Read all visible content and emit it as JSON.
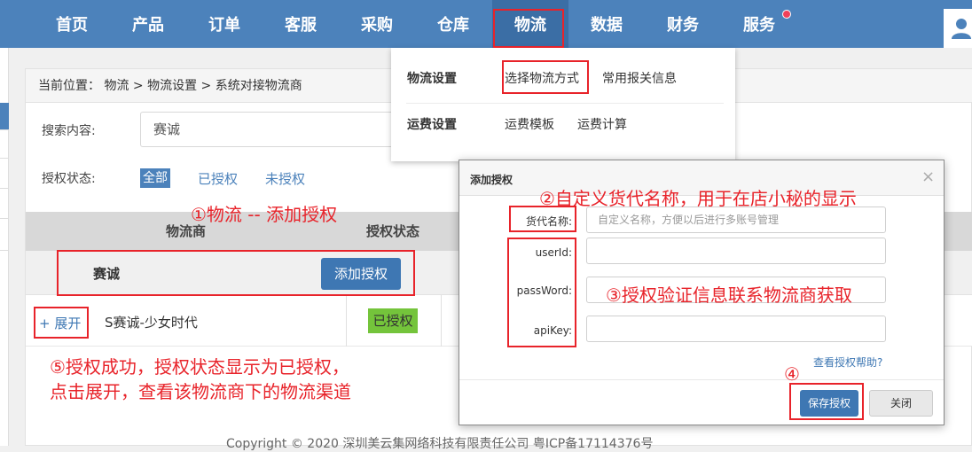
{
  "nav": {
    "items": [
      "首页",
      "产品",
      "订单",
      "客服",
      "采购",
      "仓库",
      "物流",
      "数据",
      "财务",
      "服务"
    ],
    "active": "物流"
  },
  "breadcrumb": "当前位置： 物流 > 物流设置 > 系统对接物流商",
  "search": {
    "label": "搜索内容:",
    "value": "赛诚"
  },
  "auth_filter": {
    "label": "授权状态:",
    "options": [
      "全部",
      "已授权",
      "未授权"
    ],
    "selected": "全部"
  },
  "table": {
    "headers": [
      "物流商",
      "授权状态"
    ],
    "group": {
      "name": "赛诚",
      "button": "添加授权"
    },
    "row": {
      "expand": "+ 展开",
      "channel": "S赛诚-少女时代",
      "status": "已授权"
    }
  },
  "dropdown": {
    "sections": [
      {
        "title": "物流设置",
        "links": [
          "选择物流方式",
          "常用报关信息"
        ]
      },
      {
        "title": "运费设置",
        "links": [
          "运费模板",
          "运费计算"
        ]
      }
    ]
  },
  "modal": {
    "title": "添加授权",
    "close_symbol": "×",
    "fields": [
      {
        "label": "货代名称:",
        "placeholder": "自定义名称，方便以后进行多账号管理"
      },
      {
        "label": "userId:",
        "placeholder": ""
      },
      {
        "label": "passWord:",
        "placeholder": ""
      },
      {
        "label": "apiKey:",
        "placeholder": ""
      }
    ],
    "help_link": "查看授权帮助?",
    "save_button": "保存授权",
    "close_button": "关闭"
  },
  "annotations": {
    "step1": "①物流 -- 添加授权",
    "step2": "②自定义货代名称，用于在店小秘的显示",
    "step3": "③授权验证信息联系物流商获取",
    "step4": "④",
    "step5_line1": "⑤授权成功，授权状态显示为已授权，",
    "step5_line2": "点击展开，查看该物流商下的物流渠道"
  },
  "footer": {
    "copyright": "Copyright © 2020 深圳美云集网络科技有限责任公司 粤ICP备17114376号"
  },
  "colors": {
    "nav": "#4c82bb",
    "accent": "#3e77b3",
    "annotation": "#e8232a",
    "badge": "#74c43b"
  }
}
